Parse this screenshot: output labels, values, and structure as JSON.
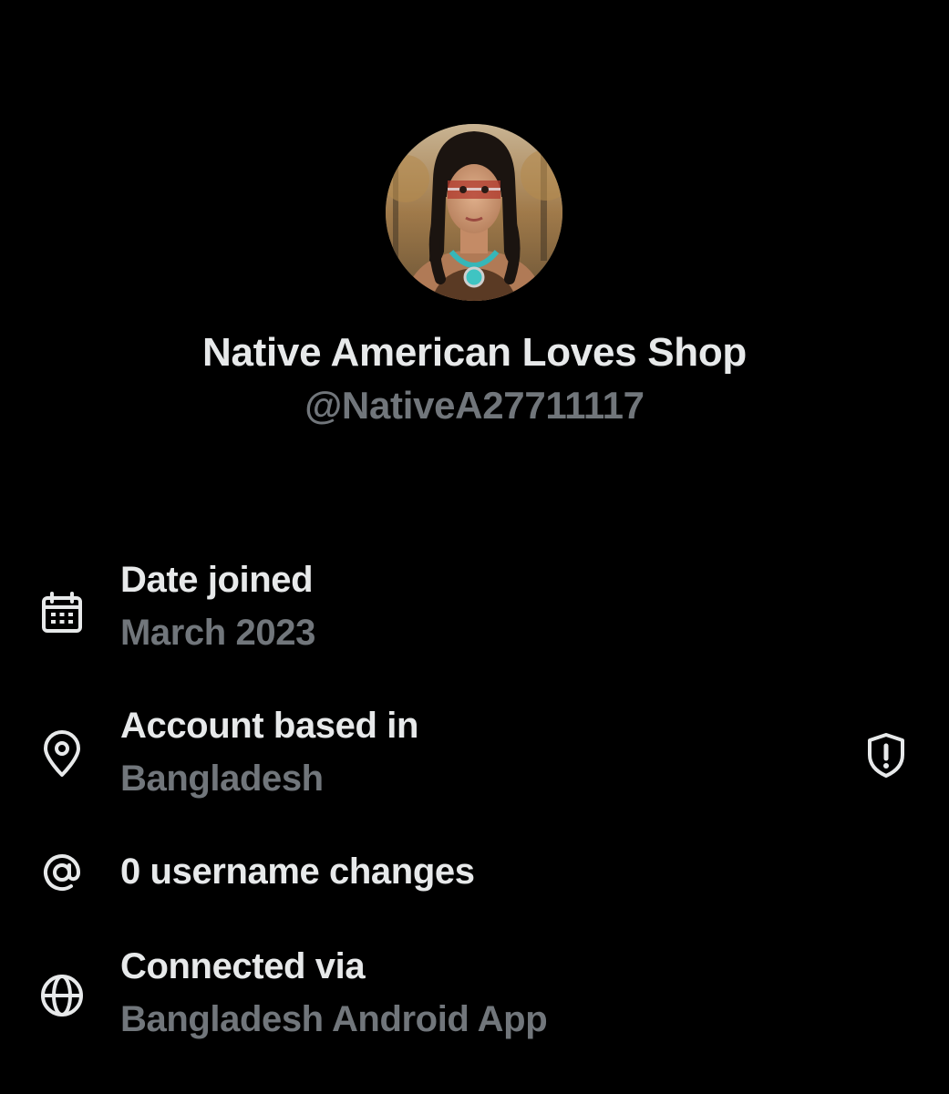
{
  "profile": {
    "display_name": "Native American Loves Shop",
    "handle": "@NativeA27711117"
  },
  "about": {
    "date_joined": {
      "icon": "calendar-icon",
      "title": "Date joined",
      "value": "March 2023"
    },
    "account_based": {
      "icon": "location-pin-icon",
      "title": "Account based in",
      "value": "Bangladesh",
      "badge_icon": "shield-alert-icon"
    },
    "username_changes": {
      "icon": "at-sign-icon",
      "title": "0 username changes"
    },
    "connected_via": {
      "icon": "globe-icon",
      "title": "Connected via",
      "value": "Bangladesh Android App"
    }
  },
  "colors": {
    "background": "#000000",
    "primary_text": "#e7e9ea",
    "secondary_text": "#71767b"
  }
}
